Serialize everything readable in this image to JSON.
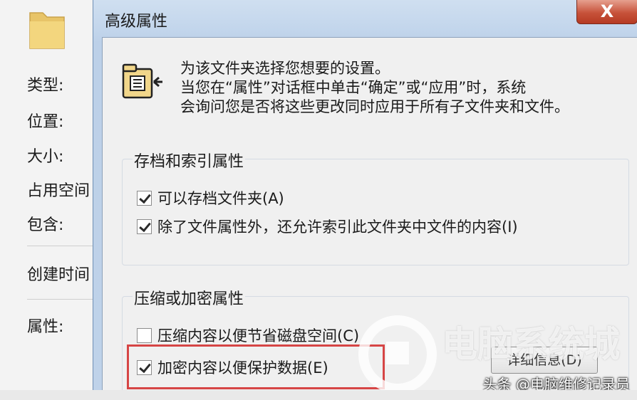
{
  "background_window": {
    "labels": [
      "类型:",
      "位置:",
      "大小:",
      "占用空间",
      "包含:",
      "创建时间",
      "属性:"
    ]
  },
  "dialog": {
    "title": "高级属性",
    "close_label": "X",
    "header": {
      "icon": "folder-properties-icon",
      "line1": "为该文件夹选择您想要的设置。",
      "line2": "当您在“属性”对话框中单击“确定”或“应用”时，系统",
      "line3": "会询问您是否将这些更改同时应用于所有子文件夹和文件。"
    },
    "archive_group": {
      "title": "存档和索引属性",
      "items": [
        {
          "label": "可以存档文件夹(A)",
          "checked": true
        },
        {
          "label": "除了文件属性外，还允许索引此文件夹中文件的内容(I)",
          "checked": true
        }
      ]
    },
    "compress_group": {
      "title": "压缩或加密属性",
      "items": [
        {
          "label": "压缩内容以便节省磁盘空间(C)",
          "checked": false
        },
        {
          "label": "加密内容以便保护数据(E)",
          "checked": true
        }
      ],
      "details_button": "详细信息(D)"
    }
  },
  "watermark": {
    "text": "电脑系统城",
    "credit": "头条 @电脑维修记录员"
  },
  "colors": {
    "highlight": "#d64545",
    "close_button": "#c7523a",
    "dialog_frame": "#c3d6ec"
  }
}
